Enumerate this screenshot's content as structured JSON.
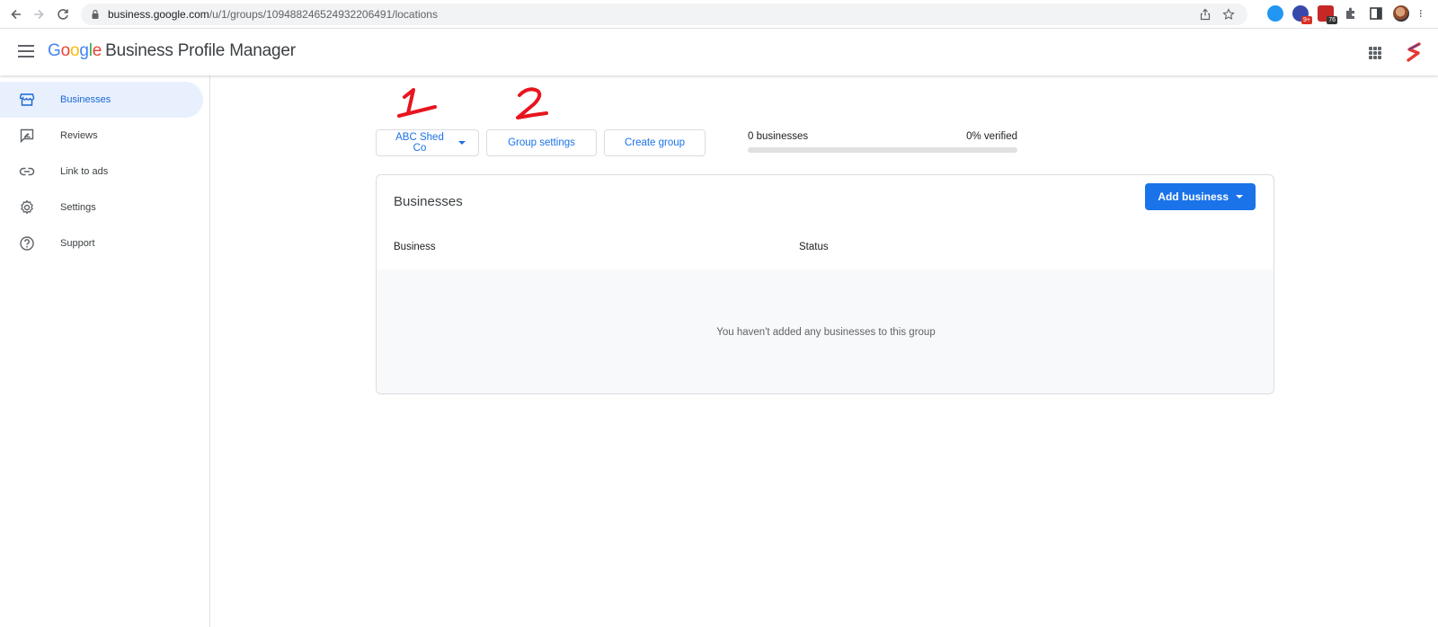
{
  "browser": {
    "url_host": "business.google.com",
    "url_path": "/u/1/groups/109488246524932206491/locations",
    "ext_badges": [
      "9+",
      "76"
    ]
  },
  "header": {
    "logo_letters": [
      "G",
      "o",
      "o",
      "g",
      "l",
      "e"
    ],
    "product_name": "Business Profile Manager"
  },
  "sidebar": {
    "items": [
      {
        "label": "Businesses",
        "icon": "storefront-icon",
        "active": true
      },
      {
        "label": "Reviews",
        "icon": "review-icon",
        "active": false
      },
      {
        "label": "Link to ads",
        "icon": "link-icon",
        "active": false
      },
      {
        "label": "Settings",
        "icon": "gear-icon",
        "active": false
      },
      {
        "label": "Support",
        "icon": "help-icon",
        "active": false
      }
    ]
  },
  "toolbar": {
    "group_dropdown_label": "ABC Shed Co",
    "group_settings_label": "Group settings",
    "create_group_label": "Create group",
    "annotations": [
      "1",
      "2"
    ]
  },
  "stats": {
    "businesses_count_text": "0 businesses",
    "verified_text": "0% verified",
    "verified_fraction": 0
  },
  "card": {
    "title": "Businesses",
    "add_button_label": "Add business",
    "columns": [
      "Business",
      "Status"
    ],
    "empty_message": "You haven't added any businesses to this group"
  },
  "colors": {
    "accent": "#1a73e8",
    "annotation": "#e8141e"
  }
}
